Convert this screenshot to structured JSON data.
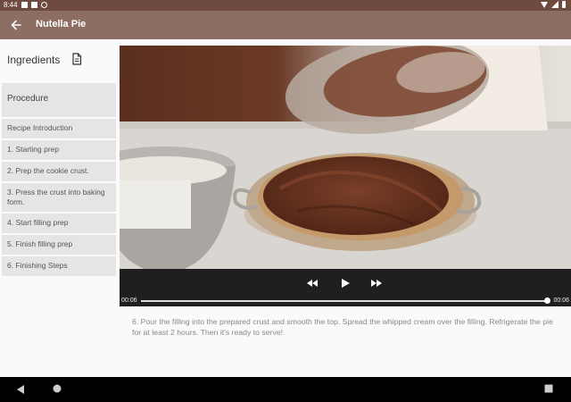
{
  "status": {
    "time": "8:44"
  },
  "appbar": {
    "title": "Nutella Pie"
  },
  "sidebar": {
    "ingredients_label": "Ingredients",
    "procedure_label": "Procedure",
    "steps": [
      "Recipe Introduction",
      "1. Starting prep",
      "2. Prep the cookie crust.",
      "3. Press the crust into baking form.",
      "4. Start filling prep",
      "5. Finish filling prep",
      "6. Finishing Steps"
    ]
  },
  "player": {
    "time_elapsed": "00:06",
    "time_total": "00:06",
    "progress": 1.0
  },
  "description": "6. Pour the filling into the prepared crust and smooth the top. Spread the whipped cream over the filling. Refrigerate the pie for at least 2 hours. Then it's ready to serve!"
}
